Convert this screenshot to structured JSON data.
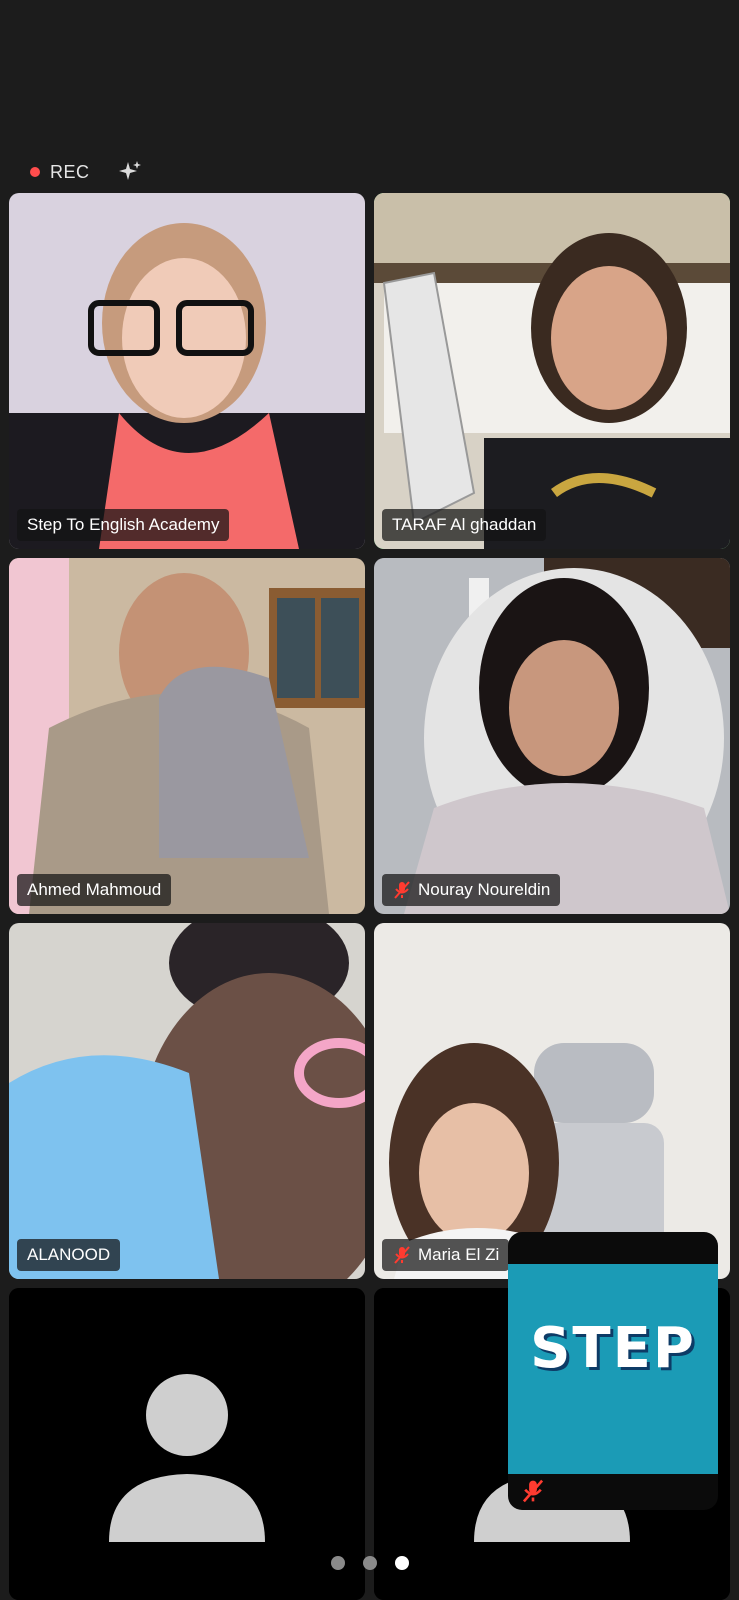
{
  "recording": {
    "label": "REC"
  },
  "participants": [
    {
      "name": "Step To English Academy",
      "muted": false,
      "active": false
    },
    {
      "name": "TARAF Al ghaddan",
      "muted": false,
      "active": true
    },
    {
      "name": "Ahmed Mahmoud",
      "muted": false,
      "active": false
    },
    {
      "name": "Nouray Noureldin",
      "muted": true,
      "active": false
    },
    {
      "name": "ALANOOD",
      "muted": false,
      "active": false
    },
    {
      "name": "Maria El Zi",
      "muted": true,
      "active": false
    },
    {
      "name": "",
      "muted": false,
      "active": false
    },
    {
      "name": "",
      "muted": false,
      "active": false
    }
  ],
  "self_view": {
    "logo_text": "STEP",
    "muted": true
  },
  "pagination": {
    "pages": 3,
    "current": 3
  },
  "colors": {
    "active_speaker": "#2ecc55",
    "rec": "#ff4d4d",
    "mute": "#ff3b30",
    "step_brand": "#1b9bb6"
  }
}
